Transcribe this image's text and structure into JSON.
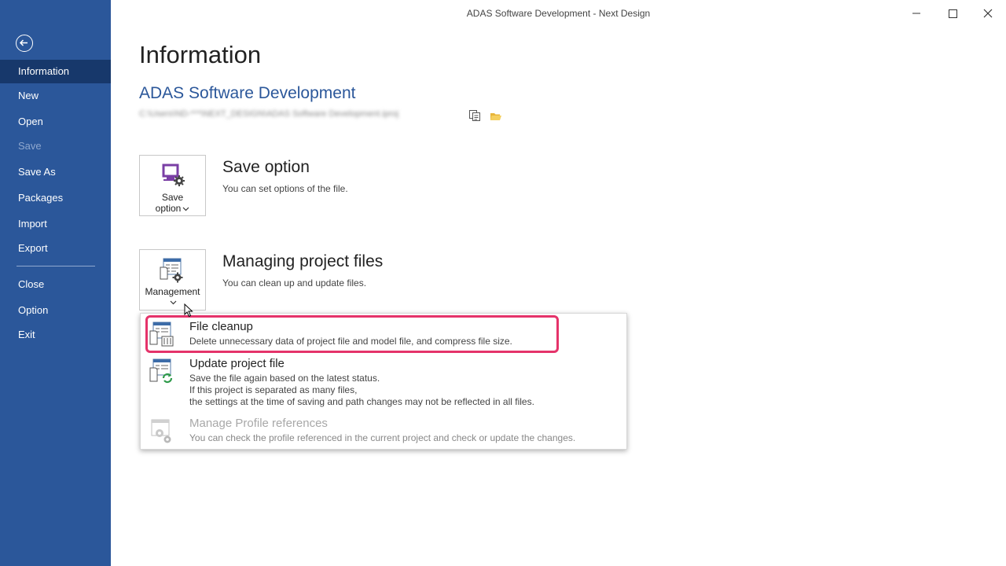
{
  "window": {
    "title": "ADAS Software Development - Next Design"
  },
  "sidebar": {
    "items": [
      {
        "label": "Information"
      },
      {
        "label": "New"
      },
      {
        "label": "Open"
      },
      {
        "label": "Save"
      },
      {
        "label": "Save As"
      },
      {
        "label": "Packages"
      },
      {
        "label": "Import"
      },
      {
        "label": "Export"
      },
      {
        "label": "Close"
      },
      {
        "label": "Option"
      },
      {
        "label": "Exit"
      }
    ],
    "active": "Information",
    "disabled": [
      "Save"
    ]
  },
  "main": {
    "page_title": "Information",
    "project_title": "ADAS Software Development",
    "project_path": "C:\\Users\\ND-***\\NEXT_DESIGN\\ADAS Software Development.iproj",
    "save_section": {
      "tile_label_1": "Save",
      "tile_label_2": "option",
      "title": "Save option",
      "description": "You can set options of the file."
    },
    "manage_section": {
      "tile_label": "Management",
      "title": "Managing project files",
      "description": "You can clean up and update files."
    }
  },
  "menu": {
    "items": [
      {
        "title": "File cleanup",
        "desc": [
          "Delete unnecessary data of project file and model file, and compress file size."
        ]
      },
      {
        "title": "Update project file",
        "desc": [
          "Save the file again based on the latest status.",
          "If this project is separated as many files,",
          "the settings at the time of saving and path changes may not be reflected in all files."
        ]
      },
      {
        "title": "Manage Profile references",
        "desc": [
          "You can check the profile referenced in the current project and check or update the changes."
        ],
        "disabled": true
      }
    ]
  },
  "colors": {
    "sidebar_bg": "#2b579a",
    "sidebar_active": "#17386b",
    "accent": "#2b579a",
    "highlight": "#e5336a"
  }
}
